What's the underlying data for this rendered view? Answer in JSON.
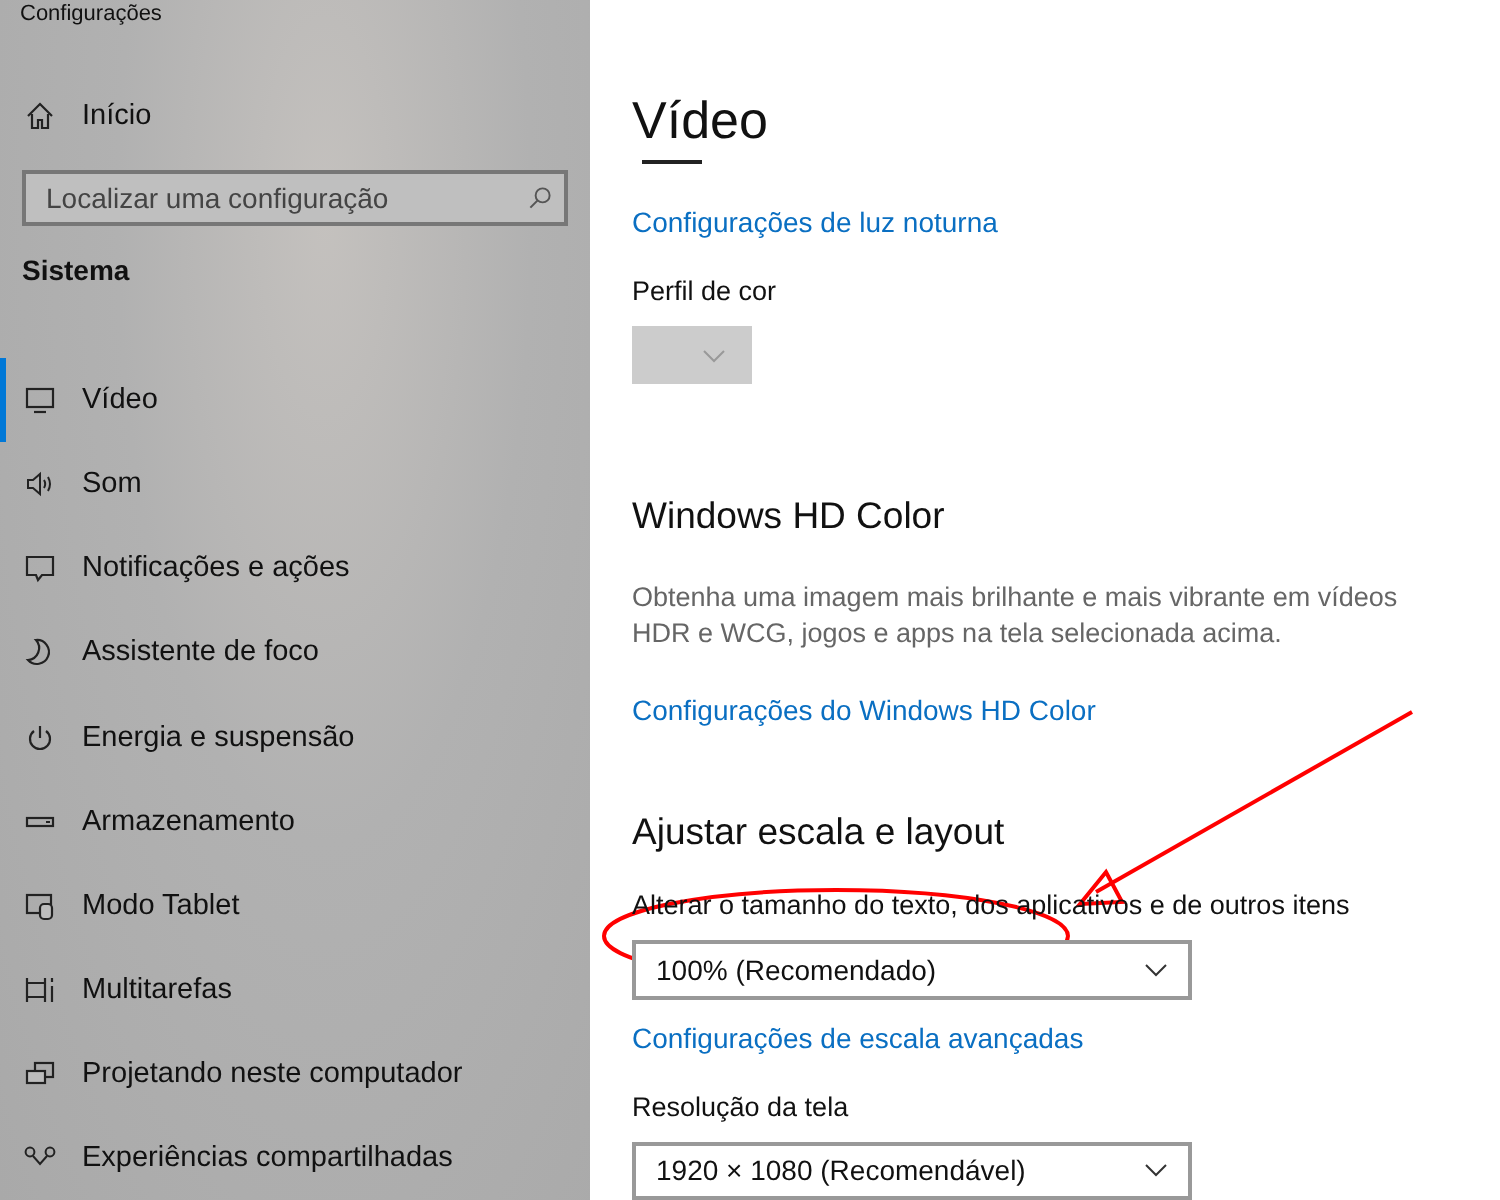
{
  "window": {
    "title": "Configurações"
  },
  "sidebar": {
    "home": {
      "label": "Início"
    },
    "search": {
      "placeholder": "Localizar uma configuração"
    },
    "section": "Sistema",
    "items": [
      {
        "label": "Vídeo",
        "selected": true
      },
      {
        "label": "Som",
        "selected": false
      },
      {
        "label": "Notificações e ações",
        "selected": false
      },
      {
        "label": "Assistente de foco",
        "selected": false
      },
      {
        "label": "Energia e suspensão",
        "selected": false
      },
      {
        "label": "Armazenamento",
        "selected": false
      },
      {
        "label": "Modo Tablet",
        "selected": false
      },
      {
        "label": "Multitarefas",
        "selected": false
      },
      {
        "label": "Projetando neste computador",
        "selected": false
      },
      {
        "label": "Experiências compartilhadas",
        "selected": false
      }
    ]
  },
  "content": {
    "title": "Vídeo",
    "sections": [
      {
        "kind": "link",
        "text": "Configurações de luz noturna"
      },
      {
        "kind": "label",
        "text": "Perfil de cor"
      },
      {
        "kind": "dropdown",
        "disabled": true
      },
      {
        "kind": "heading",
        "text": "Windows HD Color"
      },
      {
        "kind": "description",
        "text": "Obtenha uma imagem mais brilhante e mais vibrante em vídeos HDR e WCG, jogos e apps na tela selecionada acima."
      },
      {
        "kind": "link",
        "text": "Configurações do Windows HD Color"
      },
      {
        "kind": "heading",
        "text": "Ajustar escala e layout"
      },
      {
        "kind": "label",
        "text": "Alterar o tamanho do texto, dos aplicativos e de outros itens"
      },
      {
        "kind": "dropdown",
        "value": "100% (Recomendado)",
        "disabled": false
      },
      {
        "kind": "link",
        "text": "Configurações de escala avançadas"
      },
      {
        "kind": "label",
        "text": "Resolução da tela"
      },
      {
        "kind": "dropdown",
        "value": "1920 × 1080 (Recomendável)",
        "disabled": false
      }
    ]
  },
  "annotations": {
    "ellipse": true,
    "arrow": true
  }
}
